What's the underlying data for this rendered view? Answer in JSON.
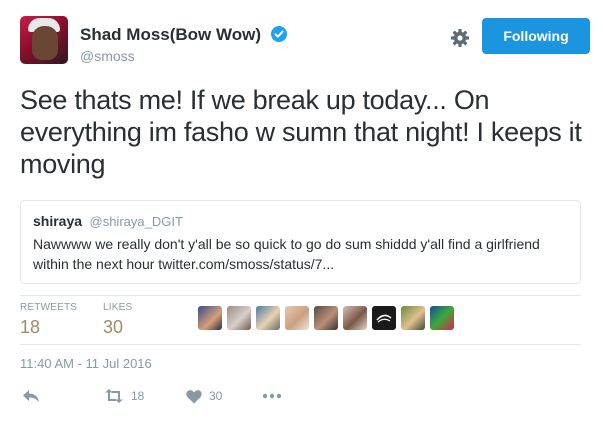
{
  "user": {
    "display_name": "Shad Moss(Bow Wow)",
    "handle": "@smoss",
    "follow_button_label": "Following"
  },
  "tweet": {
    "text": "See thats me! If we break up today... On everything im fasho w sumn that night! I keeps it moving"
  },
  "quoted_tweet": {
    "name": "shiraya",
    "handle": "@shiraya_DGIT",
    "text": "Nawwww we really don't y'all be so quick to go do sum shiddd y'all find a girlfriend within the next hour twitter.com/smoss/status/7..."
  },
  "stats": {
    "retweets_label": "RETWEETS",
    "retweets_value": "18",
    "likes_label": "LIKES",
    "likes_value": "30"
  },
  "timestamp": "11:40 AM - 11 Jul 2016",
  "actions": {
    "retweet_count": "18",
    "like_count": "30"
  },
  "colors": {
    "accent": "#1b95e0",
    "muted": "#8899a6",
    "stat_value": "#a08a68",
    "border": "#e1e8ed"
  }
}
